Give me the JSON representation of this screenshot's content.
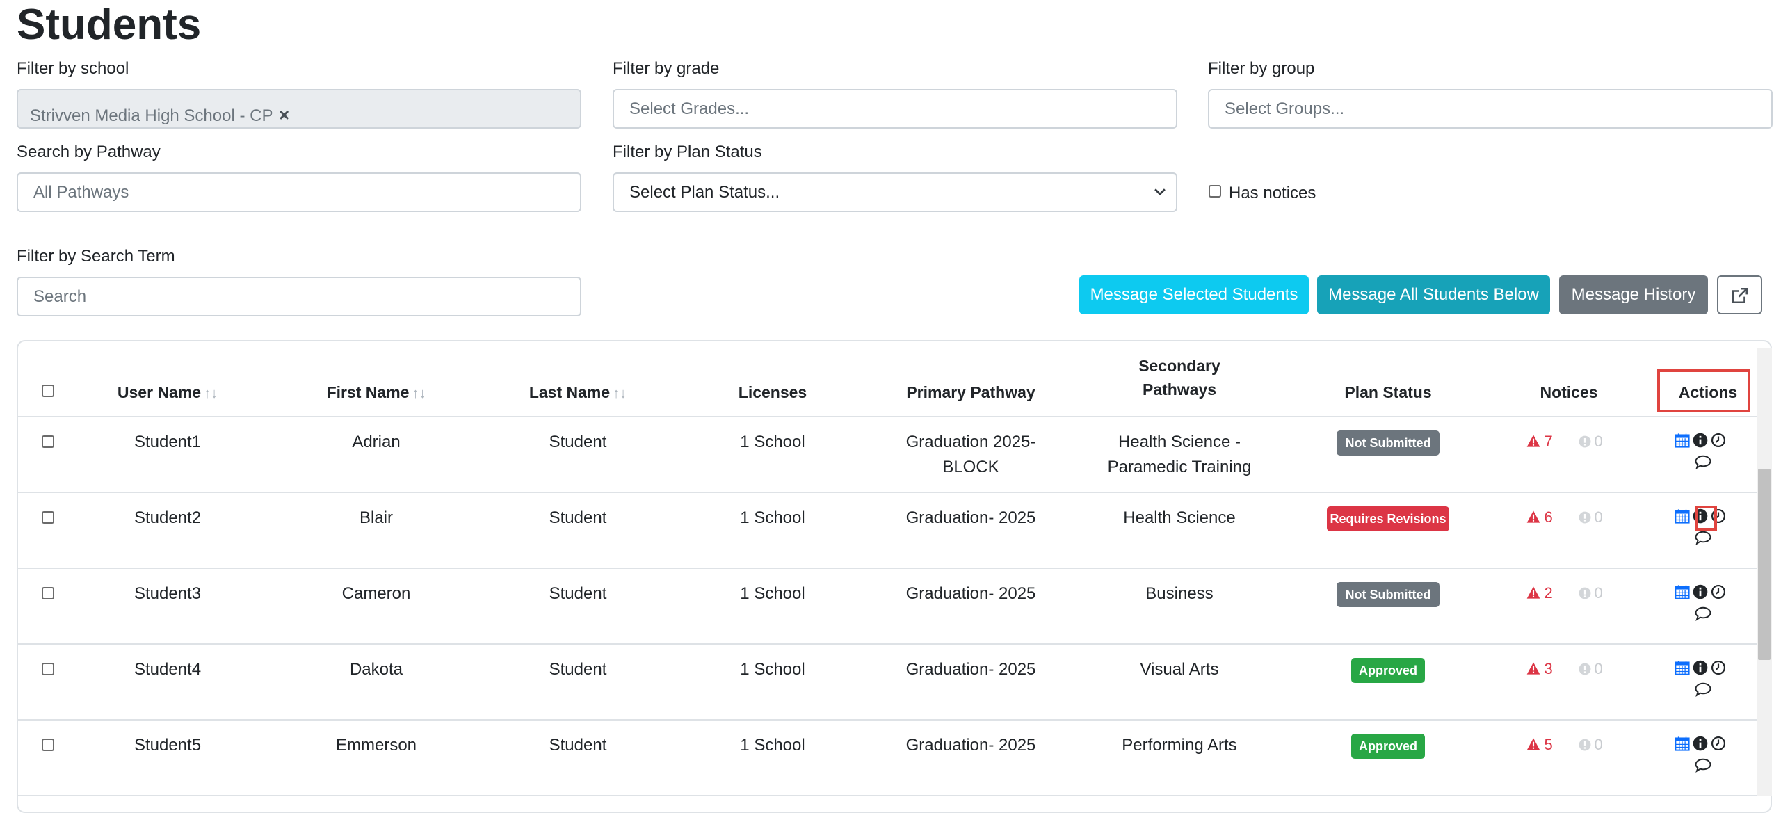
{
  "page": {
    "title": "Students"
  },
  "filters": {
    "school": {
      "label": "Filter by school",
      "chip": "Strivven Media High School - CP"
    },
    "grade": {
      "label": "Filter by grade",
      "placeholder": "Select Grades..."
    },
    "group": {
      "label": "Filter by group",
      "placeholder": "Select Groups..."
    },
    "pathway": {
      "label": "Search by Pathway",
      "placeholder": "All Pathways"
    },
    "plan_status": {
      "label": "Filter by Plan Status",
      "value": "Select Plan Status..."
    },
    "notices": {
      "label": "Has notices"
    },
    "search": {
      "label": "Filter by Search Term",
      "placeholder": "Search"
    }
  },
  "buttons": {
    "message_selected": "Message Selected Students",
    "message_all": "Message All Students Below",
    "message_history": "Message History"
  },
  "colors": {
    "primary": "#0dcaf0",
    "info": "#17a2b8",
    "secondary": "#6c757d",
    "danger": "#dc3545",
    "success": "#28a745",
    "icon_blue": "#0d6efd",
    "highlight": "#e0443f"
  },
  "table": {
    "headers": {
      "username": "User Name",
      "first": "First Name",
      "last": "Last Name",
      "licenses": "Licenses",
      "primary": "Primary Pathway",
      "secondary_1": "Secondary",
      "secondary_2": "Pathways",
      "plan_status": "Plan Status",
      "notices": "Notices",
      "actions": "Actions"
    },
    "rows": [
      {
        "username": "Student1",
        "first": "Adrian",
        "last": "Student",
        "licenses": "1 School",
        "primary_1": "Graduation 2025-",
        "primary_2": "BLOCK",
        "secondary_1": "Health Science -",
        "secondary_2": "Paramedic Training",
        "status": "Not Submitted",
        "status_color": "#6c757d",
        "warn": "7",
        "info": "0"
      },
      {
        "username": "Student2",
        "first": "Blair",
        "last": "Student",
        "licenses": "1 School",
        "primary_1": "Graduation- 2025",
        "primary_2": "",
        "secondary_1": "Health Science",
        "secondary_2": "",
        "status": "Requires Revisions",
        "status_color": "#dc3545",
        "warn": "6",
        "info": "0"
      },
      {
        "username": "Student3",
        "first": "Cameron",
        "last": "Student",
        "licenses": "1 School",
        "primary_1": "Graduation- 2025",
        "primary_2": "",
        "secondary_1": "Business",
        "secondary_2": "",
        "status": "Not Submitted",
        "status_color": "#6c757d",
        "warn": "2",
        "info": "0"
      },
      {
        "username": "Student4",
        "first": "Dakota",
        "last": "Student",
        "licenses": "1 School",
        "primary_1": "Graduation- 2025",
        "primary_2": "",
        "secondary_1": "Visual Arts",
        "secondary_2": "",
        "status": "Approved",
        "status_color": "#28a745",
        "warn": "3",
        "info": "0"
      },
      {
        "username": "Student5",
        "first": "Emmerson",
        "last": "Student",
        "licenses": "1 School",
        "primary_1": "Graduation- 2025",
        "primary_2": "",
        "secondary_1": "Performing Arts",
        "secondary_2": "",
        "status": "Approved",
        "status_color": "#28a745",
        "warn": "5",
        "info": "0"
      }
    ]
  }
}
